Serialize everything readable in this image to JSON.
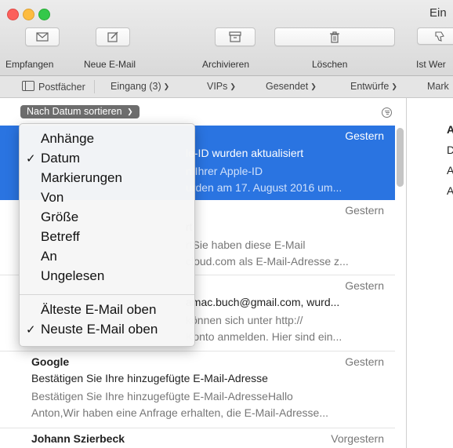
{
  "window": {
    "title": "Ein"
  },
  "toolbar": {
    "buttons": [
      {
        "label": "Empfangen",
        "icon": "envelope-icon"
      },
      {
        "label": "Neue E-Mail",
        "icon": "compose-icon"
      },
      {
        "label": "Archivieren",
        "icon": "archive-icon"
      },
      {
        "label": "Löschen",
        "icon": "trash-icon"
      },
      {
        "label": "Ist Wer",
        "icon": "thumbs-down-icon"
      }
    ]
  },
  "favorites": {
    "mailboxes": "Postfächer",
    "inbox": "Eingang (3)",
    "vips": "VIPs",
    "sent": "Gesendet",
    "drafts": "Entwürfe",
    "more": "Mark"
  },
  "sort": {
    "label": "Nach Datum sortieren"
  },
  "messages": [
    {
      "from": "",
      "date": "Gestern",
      "subject": "le-ID wurden aktualisiert",
      "preview1": "n Ihrer Apple-ID",
      "preview2": "urden am 17. August 2016 um..."
    },
    {
      "from": "",
      "date": "Gestern",
      "subject": "rt",
      "preview1": "rtSie haben diese E-Mail",
      "preview2": "cloud.com als E-Mail-Adresse z..."
    },
    {
      "from": "",
      "date": "Gestern",
      "subject": "amac.buch@gmail.com, wurd...",
      "preview1": "können sich unter http://",
      "preview2": "Konto anmelden. Hier sind ein..."
    },
    {
      "from": "Google",
      "date": "Gestern",
      "subject": "Bestätigen Sie Ihre hinzugefügte E-Mail-Adresse",
      "preview1": "Bestätigen Sie Ihre hinzugefügte E-Mail-AdresseHallo",
      "preview2": "Anton,Wir haben eine Anfrage erhalten, die E-Mail-Adresse..."
    },
    {
      "from": "Johann Szierbeck",
      "date": "Vorgestern",
      "subject": "",
      "preview1": "",
      "preview2": ""
    }
  ],
  "preview_pane": {
    "lines": [
      "A",
      "D",
      "A",
      "A"
    ]
  },
  "sort_menu": {
    "items": [
      "Anhänge",
      "Datum",
      "Markierungen",
      "Von",
      "Größe",
      "Betreff",
      "An",
      "Ungelesen"
    ],
    "checked_item": "Datum",
    "order_items": [
      "Älteste E-Mail oben",
      "Neuste E-Mail oben"
    ],
    "checked_order": "Neuste E-Mail oben",
    "check_glyph": "✓"
  },
  "colors": {
    "selection": "#2a74e1",
    "sort_button": "#6d6d6d"
  }
}
